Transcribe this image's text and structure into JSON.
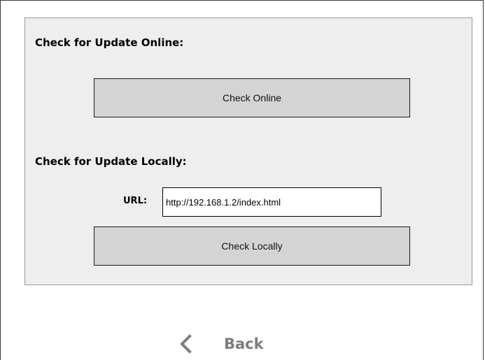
{
  "online": {
    "title": "Check for Update Online:",
    "button_label": "Check Online"
  },
  "local": {
    "title": "Check for Update Locally:",
    "url_label": "URL:",
    "url_value": "http://192.168.1.2/index.html",
    "button_label": "Check Locally"
  },
  "nav": {
    "back_label": "Back",
    "back_icon": "chevron-left-icon"
  },
  "colors": {
    "panel_bg": "#eeeeee",
    "button_bg": "#d4d4d4",
    "back_text": "#7d7d7d"
  }
}
